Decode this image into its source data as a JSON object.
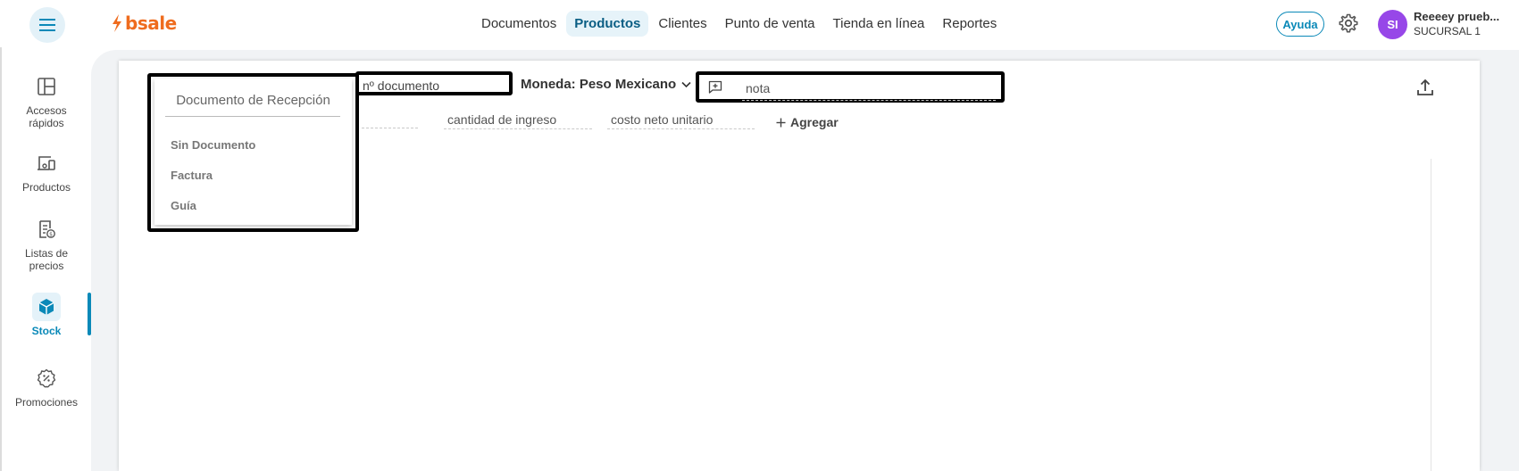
{
  "brand": {
    "name": "bsale",
    "color": "#ef6c1e"
  },
  "nav": [
    {
      "label": "Documentos",
      "active": false
    },
    {
      "label": "Productos",
      "active": true
    },
    {
      "label": "Clientes",
      "active": false
    },
    {
      "label": "Punto de venta",
      "active": false
    },
    {
      "label": "Tienda en línea",
      "active": false
    },
    {
      "label": "Reportes",
      "active": false
    }
  ],
  "header": {
    "help_label": "Ayuda",
    "avatar_initials": "SI",
    "user_name": "Reeeey prueb...",
    "user_branch": "SUCURSAL 1"
  },
  "sidebar": {
    "items": [
      {
        "label": "Accesos rápidos",
        "icon": "layout-icon"
      },
      {
        "label": "Productos",
        "icon": "products-icon"
      },
      {
        "label": "Listas de precios",
        "icon": "price-list-icon"
      },
      {
        "label": "Stock",
        "icon": "box-icon",
        "active": true
      },
      {
        "label": "Promociones",
        "icon": "promo-icon"
      }
    ]
  },
  "form": {
    "doc_number_placeholder": "nº documento",
    "currency_label": "Moneda: Peso Mexicano",
    "note_placeholder": "nota",
    "quantity_placeholder": "cantidad de ingreso",
    "cost_placeholder": "costo neto unitario",
    "add_label": "Agregar"
  },
  "dropdown": {
    "title": "Documento de Recepción",
    "options": [
      "Sin Documento",
      "Factura",
      "Guía"
    ]
  },
  "colors": {
    "accent": "#0a89b8",
    "avatar": "#9747e8"
  }
}
